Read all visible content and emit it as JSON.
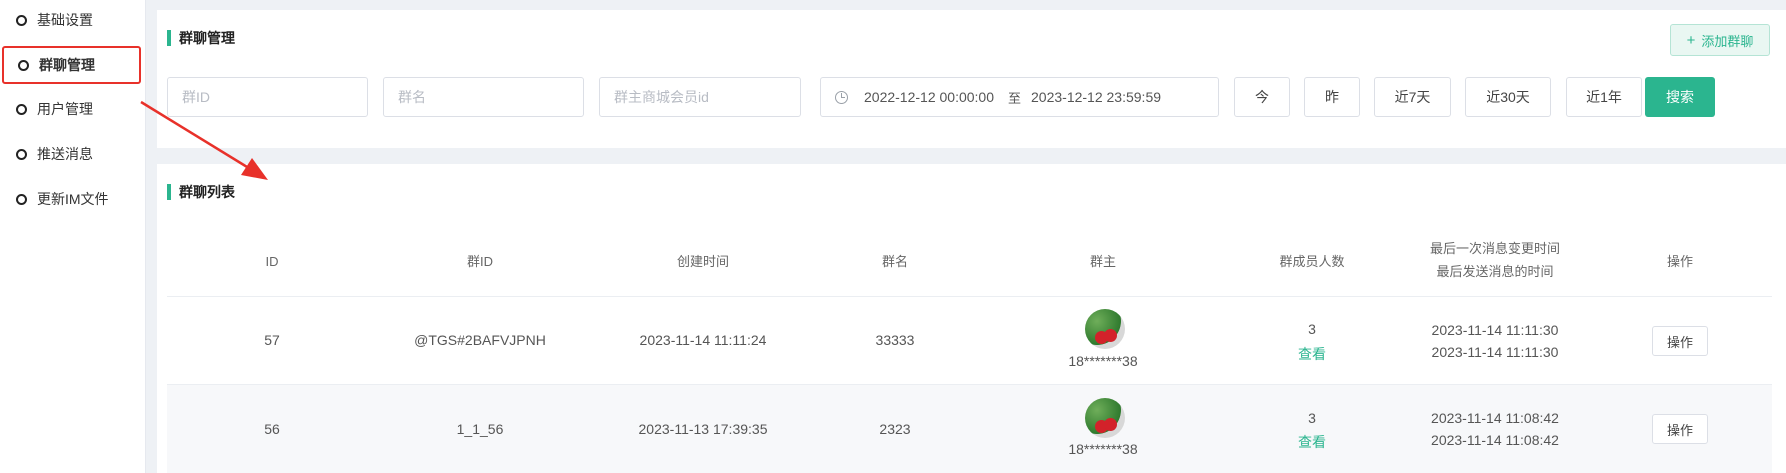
{
  "sidebar": {
    "items": [
      {
        "label": "基础设置"
      },
      {
        "label": "群聊管理"
      },
      {
        "label": "用户管理"
      },
      {
        "label": "推送消息"
      },
      {
        "label": "更新IM文件"
      }
    ],
    "active_index": 1
  },
  "search_panel": {
    "title": "群聊管理",
    "add_button": "添加群聊",
    "group_id_placeholder": "群ID",
    "group_name_placeholder": "群名",
    "owner_id_placeholder": "群主商城会员id",
    "date_start": "2022-12-12 00:00:00",
    "date_separator": "至",
    "date_end": "2023-12-12 23:59:59",
    "quick_buttons": [
      "今",
      "昨",
      "近7天",
      "近30天",
      "近1年"
    ],
    "search_button": "搜索"
  },
  "list": {
    "title": "群聊列表",
    "headers": {
      "id": "ID",
      "group_id": "群ID",
      "created": "创建时间",
      "name": "群名",
      "owner": "群主",
      "members": "群成员人数",
      "last_change": "最后一次消息变更时间",
      "last_send": "最后发送消息的时间",
      "action": "操作"
    },
    "rows": [
      {
        "id": "57",
        "group_id": "@TGS#2BAFVJPNH",
        "created": "2023-11-14 11:11:24",
        "name": "33333",
        "owner": "18*******38",
        "members": "3",
        "view": "查看",
        "last_change": "2023-11-14 11:11:30",
        "last_send": "2023-11-14 11:11:30",
        "action": "操作"
      },
      {
        "id": "56",
        "group_id": "1_1_56",
        "created": "2023-11-13 17:39:35",
        "name": "2323",
        "owner": "18*******38",
        "members": "3",
        "view": "查看",
        "last_change": "2023-11-14 11:08:42",
        "last_send": "2023-11-14 11:08:42",
        "action": "操作"
      }
    ]
  },
  "colors": {
    "accent": "#2bb58f",
    "annotation": "#e8312a"
  }
}
